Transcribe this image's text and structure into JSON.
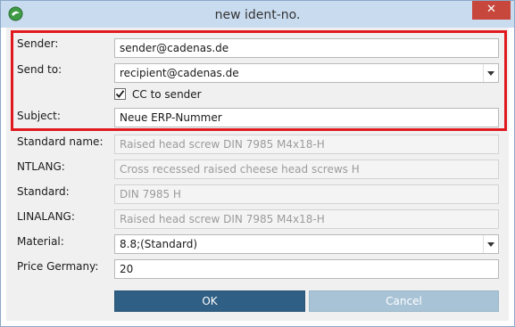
{
  "window": {
    "title": "new ident-no.",
    "close_glyph": "✕"
  },
  "form": {
    "sender": {
      "label": "Sender:",
      "value": "sender@cadenas.de"
    },
    "send_to": {
      "label": "Send to:",
      "value": "recipient@cadenas.de"
    },
    "cc_to_sender": {
      "label": "CC to sender",
      "checked": true
    },
    "subject": {
      "label": "Subject:",
      "value": "Neue ERP-Nummer"
    },
    "standard_name": {
      "label": "Standard name:",
      "value": "Raised head screw DIN 7985 M4x18-H"
    },
    "ntlang": {
      "label": "NTLANG:",
      "value": "Cross recessed raised cheese head screws H"
    },
    "standard": {
      "label": "Standard:",
      "value": "DIN 7985 H"
    },
    "linalang": {
      "label": "LINALANG:",
      "value": "Raised head screw DIN 7985 M4x18-H"
    },
    "material": {
      "label": "Material:",
      "value": "8.8;(Standard)"
    },
    "price_germany": {
      "label": "Price Germany:",
      "value": "20"
    }
  },
  "buttons": {
    "ok": "OK",
    "cancel": "Cancel"
  },
  "colors": {
    "titlebar": "#c9dbef",
    "close_button": "#c8473c",
    "highlight": "#e0191f",
    "ok_button": "#2f5f84",
    "cancel_button": "#a8c3d6"
  },
  "icons": {
    "app": "app-logo-icon",
    "close": "close-icon",
    "dropdown": "chevron-down-icon",
    "check": "checkmark-icon"
  }
}
